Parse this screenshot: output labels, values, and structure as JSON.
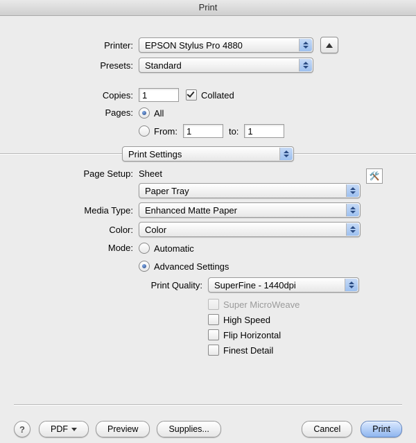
{
  "window": {
    "title": "Print"
  },
  "printer": {
    "label": "Printer:",
    "value": "EPSON Stylus Pro 4880"
  },
  "presets": {
    "label": "Presets:",
    "value": "Standard"
  },
  "copies": {
    "label": "Copies:",
    "value": "1",
    "collated_label": "Collated",
    "collated_checked": true
  },
  "pages": {
    "label": "Pages:",
    "all_label": "All",
    "all_selected": true,
    "from_label": "From:",
    "from_value": "1",
    "to_label": "to:",
    "to_value": "1",
    "from_selected": false
  },
  "pane": {
    "value": "Print Settings"
  },
  "page_setup": {
    "label": "Page Setup:",
    "value": "Sheet"
  },
  "paper_source": {
    "value": "Paper Tray"
  },
  "media_type": {
    "label": "Media Type:",
    "value": "Enhanced Matte Paper"
  },
  "color": {
    "label": "Color:",
    "value": "Color"
  },
  "mode": {
    "label": "Mode:",
    "automatic_label": "Automatic",
    "automatic_selected": false,
    "advanced_label": "Advanced Settings",
    "advanced_selected": true
  },
  "print_quality": {
    "label": "Print Quality:",
    "value": "SuperFine - 1440dpi"
  },
  "options": {
    "super_microweave": {
      "label": "Super MicroWeave",
      "checked": false,
      "enabled": false
    },
    "high_speed": {
      "label": "High Speed",
      "checked": false,
      "enabled": true
    },
    "flip_horizontal": {
      "label": "Flip Horizontal",
      "checked": false,
      "enabled": true
    },
    "finest_detail": {
      "label": "Finest Detail",
      "checked": false,
      "enabled": true
    }
  },
  "buttons": {
    "help": "?",
    "pdf": "PDF",
    "preview": "Preview",
    "supplies": "Supplies...",
    "cancel": "Cancel",
    "print": "Print"
  }
}
